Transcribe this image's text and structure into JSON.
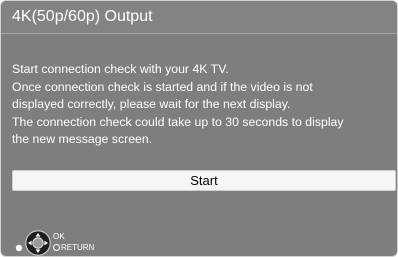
{
  "screen": {
    "title": "4K(50p/60p) Output"
  },
  "message": {
    "lines": [
      "Start connection check with your 4K TV.",
      "Once connection check is started and if the video is not",
      "displayed correctly, please wait for the next display.",
      "The connection check could take up to 30 seconds to display",
      "the new message screen."
    ]
  },
  "buttons": {
    "start_label": "Start"
  },
  "legend": {
    "ok_label": "OK",
    "return_label": "RETURN",
    "icons": [
      "dpad-icon",
      "return-dot-icon"
    ]
  },
  "colors": {
    "background": "#7e7e7e",
    "title_bar": "#838383",
    "button_fill": "#f5f5f5",
    "text": "#ffffff"
  }
}
